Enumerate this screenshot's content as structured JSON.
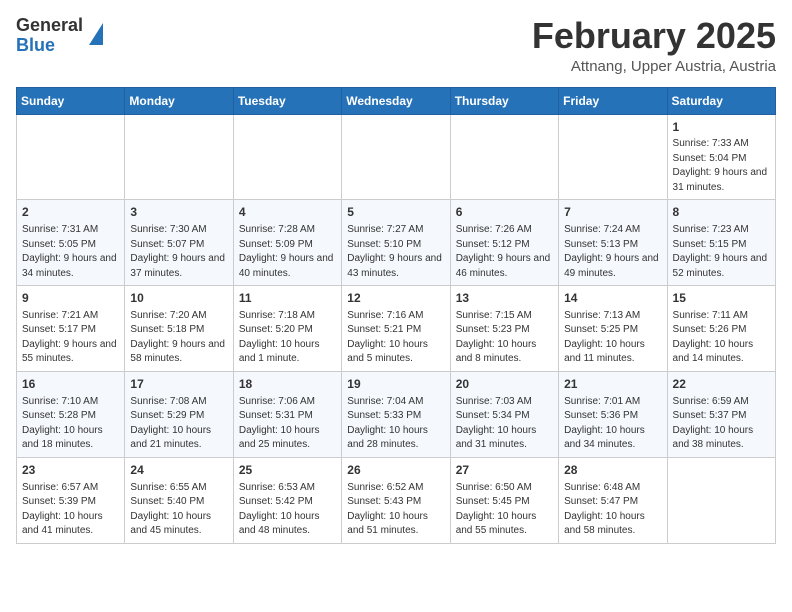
{
  "header": {
    "logo_general": "General",
    "logo_blue": "Blue",
    "month": "February 2025",
    "location": "Attnang, Upper Austria, Austria"
  },
  "weekdays": [
    "Sunday",
    "Monday",
    "Tuesday",
    "Wednesday",
    "Thursday",
    "Friday",
    "Saturday"
  ],
  "weeks": [
    [
      {
        "day": "",
        "info": ""
      },
      {
        "day": "",
        "info": ""
      },
      {
        "day": "",
        "info": ""
      },
      {
        "day": "",
        "info": ""
      },
      {
        "day": "",
        "info": ""
      },
      {
        "day": "",
        "info": ""
      },
      {
        "day": "1",
        "info": "Sunrise: 7:33 AM\nSunset: 5:04 PM\nDaylight: 9 hours and 31 minutes."
      }
    ],
    [
      {
        "day": "2",
        "info": "Sunrise: 7:31 AM\nSunset: 5:05 PM\nDaylight: 9 hours and 34 minutes."
      },
      {
        "day": "3",
        "info": "Sunrise: 7:30 AM\nSunset: 5:07 PM\nDaylight: 9 hours and 37 minutes."
      },
      {
        "day": "4",
        "info": "Sunrise: 7:28 AM\nSunset: 5:09 PM\nDaylight: 9 hours and 40 minutes."
      },
      {
        "day": "5",
        "info": "Sunrise: 7:27 AM\nSunset: 5:10 PM\nDaylight: 9 hours and 43 minutes."
      },
      {
        "day": "6",
        "info": "Sunrise: 7:26 AM\nSunset: 5:12 PM\nDaylight: 9 hours and 46 minutes."
      },
      {
        "day": "7",
        "info": "Sunrise: 7:24 AM\nSunset: 5:13 PM\nDaylight: 9 hours and 49 minutes."
      },
      {
        "day": "8",
        "info": "Sunrise: 7:23 AM\nSunset: 5:15 PM\nDaylight: 9 hours and 52 minutes."
      }
    ],
    [
      {
        "day": "9",
        "info": "Sunrise: 7:21 AM\nSunset: 5:17 PM\nDaylight: 9 hours and 55 minutes."
      },
      {
        "day": "10",
        "info": "Sunrise: 7:20 AM\nSunset: 5:18 PM\nDaylight: 9 hours and 58 minutes."
      },
      {
        "day": "11",
        "info": "Sunrise: 7:18 AM\nSunset: 5:20 PM\nDaylight: 10 hours and 1 minute."
      },
      {
        "day": "12",
        "info": "Sunrise: 7:16 AM\nSunset: 5:21 PM\nDaylight: 10 hours and 5 minutes."
      },
      {
        "day": "13",
        "info": "Sunrise: 7:15 AM\nSunset: 5:23 PM\nDaylight: 10 hours and 8 minutes."
      },
      {
        "day": "14",
        "info": "Sunrise: 7:13 AM\nSunset: 5:25 PM\nDaylight: 10 hours and 11 minutes."
      },
      {
        "day": "15",
        "info": "Sunrise: 7:11 AM\nSunset: 5:26 PM\nDaylight: 10 hours and 14 minutes."
      }
    ],
    [
      {
        "day": "16",
        "info": "Sunrise: 7:10 AM\nSunset: 5:28 PM\nDaylight: 10 hours and 18 minutes."
      },
      {
        "day": "17",
        "info": "Sunrise: 7:08 AM\nSunset: 5:29 PM\nDaylight: 10 hours and 21 minutes."
      },
      {
        "day": "18",
        "info": "Sunrise: 7:06 AM\nSunset: 5:31 PM\nDaylight: 10 hours and 25 minutes."
      },
      {
        "day": "19",
        "info": "Sunrise: 7:04 AM\nSunset: 5:33 PM\nDaylight: 10 hours and 28 minutes."
      },
      {
        "day": "20",
        "info": "Sunrise: 7:03 AM\nSunset: 5:34 PM\nDaylight: 10 hours and 31 minutes."
      },
      {
        "day": "21",
        "info": "Sunrise: 7:01 AM\nSunset: 5:36 PM\nDaylight: 10 hours and 34 minutes."
      },
      {
        "day": "22",
        "info": "Sunrise: 6:59 AM\nSunset: 5:37 PM\nDaylight: 10 hours and 38 minutes."
      }
    ],
    [
      {
        "day": "23",
        "info": "Sunrise: 6:57 AM\nSunset: 5:39 PM\nDaylight: 10 hours and 41 minutes."
      },
      {
        "day": "24",
        "info": "Sunrise: 6:55 AM\nSunset: 5:40 PM\nDaylight: 10 hours and 45 minutes."
      },
      {
        "day": "25",
        "info": "Sunrise: 6:53 AM\nSunset: 5:42 PM\nDaylight: 10 hours and 48 minutes."
      },
      {
        "day": "26",
        "info": "Sunrise: 6:52 AM\nSunset: 5:43 PM\nDaylight: 10 hours and 51 minutes."
      },
      {
        "day": "27",
        "info": "Sunrise: 6:50 AM\nSunset: 5:45 PM\nDaylight: 10 hours and 55 minutes."
      },
      {
        "day": "28",
        "info": "Sunrise: 6:48 AM\nSunset: 5:47 PM\nDaylight: 10 hours and 58 minutes."
      },
      {
        "day": "",
        "info": ""
      }
    ]
  ]
}
